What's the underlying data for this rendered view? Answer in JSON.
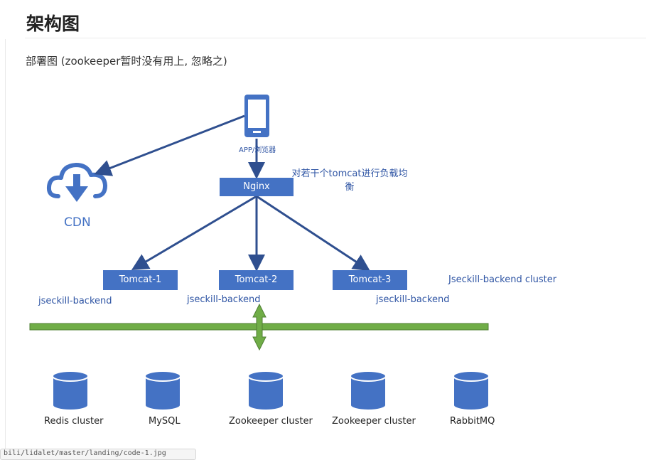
{
  "page": {
    "title": "架构图",
    "subtitle": "部署图 (zookeeper暂时没有用上, 忽略之)"
  },
  "diagram": {
    "client_label": "APP/浏览器",
    "cdn_label": "CDN",
    "nginx_label": "Nginx",
    "nginx_note": "对若干个tomcat进行负载均衡",
    "tomcats": [
      "Tomcat-1",
      "Tomcat-2",
      "Tomcat-3"
    ],
    "backend_label": "jseckill-backend",
    "cluster_label": "Jseckill-backend cluster",
    "datastores": [
      "Redis cluster",
      "MySQL",
      "Zookeeper cluster",
      "Zookeeper cluster",
      "RabbitMQ"
    ],
    "colors": {
      "node": "#4472c4",
      "arrow": "#2f4f8f",
      "bus": "#70ad47",
      "label": "#2f55a4"
    }
  },
  "status_bar": {
    "url": "bili/lidalet/master/landing/code-1.jpg"
  }
}
